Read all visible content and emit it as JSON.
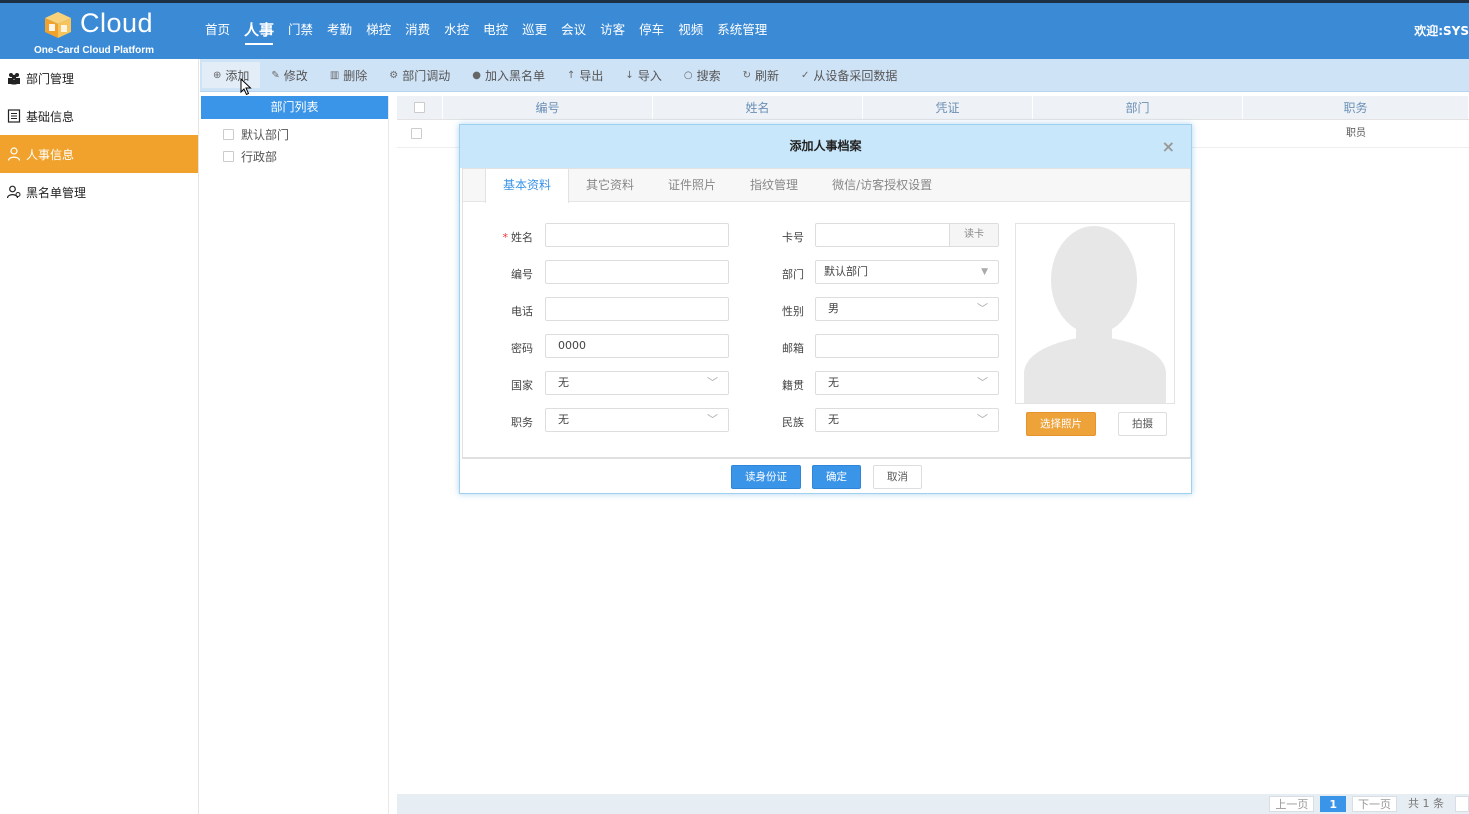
{
  "header": {
    "logo_text": "Cloud",
    "logo_sub": "One-Card Cloud Platform",
    "nav": [
      "首页",
      "人事",
      "门禁",
      "考勤",
      "梯控",
      "消费",
      "水控",
      "电控",
      "巡更",
      "会议",
      "访客",
      "停车",
      "视频",
      "系统管理"
    ],
    "nav_active": "人事",
    "welcome": "欢迎:SYS"
  },
  "sidebar": {
    "items": [
      {
        "label": "部门管理",
        "icon": "group-icon"
      },
      {
        "label": "基础信息",
        "icon": "document-icon"
      },
      {
        "label": "人事信息",
        "icon": "person-icon"
      },
      {
        "label": "黑名单管理",
        "icon": "blacklist-icon"
      }
    ],
    "active_index": 2
  },
  "toolbar": {
    "add": "添加",
    "edit": "修改",
    "delete": "删除",
    "transfer": "部门调动",
    "blacklist": "加入黑名单",
    "export": "导出",
    "import": "导入",
    "search": "搜索",
    "refresh": "刷新",
    "fetch": "从设备采回数据"
  },
  "dept": {
    "header": "部门列表",
    "items": [
      "默认部门",
      "行政部"
    ]
  },
  "grid": {
    "columns": [
      "编号",
      "姓名",
      "凭证",
      "部门",
      "职务"
    ],
    "rows": [
      {
        "position": "职员"
      }
    ]
  },
  "pager": {
    "prev": "上一页",
    "current": "1",
    "next": "下一页",
    "total": "共 1 条"
  },
  "modal": {
    "title": "添加人事档案",
    "close": "×",
    "tabs": [
      "基本资料",
      "其它资料",
      "证件照片",
      "指纹管理",
      "微信/访客授权设置"
    ],
    "active_tab": 0,
    "left_fields": [
      {
        "label": "姓名",
        "value": "",
        "type": "text",
        "required": true
      },
      {
        "label": "编号",
        "value": "",
        "type": "text"
      },
      {
        "label": "电话",
        "value": "",
        "type": "text"
      },
      {
        "label": "密码",
        "value": "0000",
        "type": "text"
      },
      {
        "label": "国家",
        "value": "无",
        "type": "select"
      },
      {
        "label": "职务",
        "value": "无",
        "type": "select"
      }
    ],
    "right_fields": [
      {
        "label": "卡号",
        "value": "",
        "type": "card"
      },
      {
        "label": "部门",
        "value": "默认部门",
        "type": "combo"
      },
      {
        "label": "性别",
        "value": "男",
        "type": "select"
      },
      {
        "label": "邮箱",
        "value": "",
        "type": "text"
      },
      {
        "label": "籍贯",
        "value": "无",
        "type": "select"
      },
      {
        "label": "民族",
        "value": "无",
        "type": "select"
      }
    ],
    "read_card": "读卡",
    "choose_photo": "选择照片",
    "take_photo": "拍摄",
    "read_id": "读身份证",
    "confirm": "确定",
    "cancel": "取消"
  },
  "colors": {
    "header": "#3a8ad6",
    "accent_blue": "#3a94e8",
    "sidebar_active": "#f0a22c",
    "toolbar": "#cfe3f7",
    "modal_title": "#c9e7fa"
  }
}
